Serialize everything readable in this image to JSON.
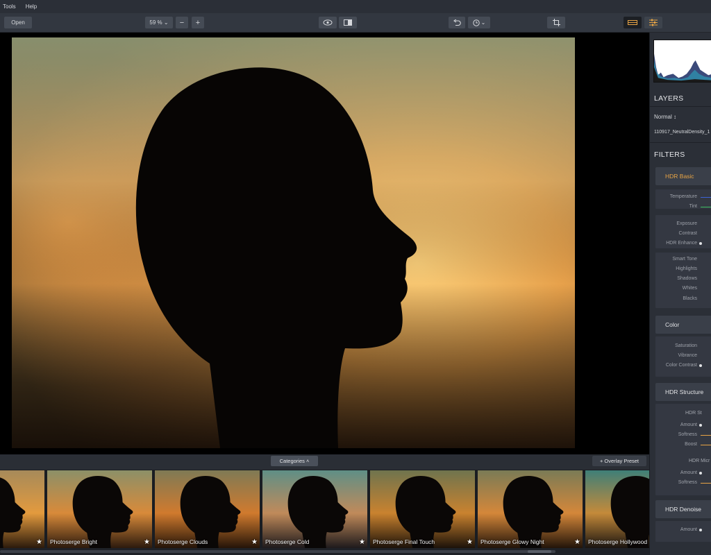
{
  "menu": {
    "items": [
      {
        "label": "Tools"
      },
      {
        "label": "Help"
      }
    ]
  },
  "toolbar": {
    "open_label": "Open",
    "zoom_label": "59 % ⌄",
    "zoom_out_label": "−",
    "zoom_in_label": "+",
    "history_label": "⌄"
  },
  "panel": {
    "layers_title": "LAYERS",
    "blend_mode": "Normal ↕",
    "layer_name": "110917_NeutralDensity_1",
    "filters_title": "FILTERS",
    "hdr_basic": {
      "title": "HDR Basic",
      "g1": [
        "Temperature",
        "Tint"
      ],
      "g2": [
        "Exposure",
        "Contrast",
        "HDR Enhance"
      ],
      "g3": [
        "Smart Tone",
        "Highlights",
        "Shadows",
        "Whites",
        "Blacks"
      ]
    },
    "color": {
      "title": "Color",
      "rows": [
        "Saturation",
        "Vibrance",
        "Color Contrast"
      ]
    },
    "hdr_structure": {
      "title": "HDR Structure",
      "sub1": "HDR St",
      "sub1_rows": [
        "Amount",
        "Softness",
        "Boost"
      ],
      "sub2": "HDR Micr",
      "sub2_rows": [
        "Amount",
        "Softness"
      ]
    },
    "hdr_denoise": {
      "title": "HDR Denoise",
      "rows": [
        "Amount"
      ]
    }
  },
  "strip": {
    "categories_label": "Categories ˄",
    "overlay_label": "+ Overlay Preset",
    "presets": [
      {
        "label": ""
      },
      {
        "label": "Photoserge Bright"
      },
      {
        "label": "Photoserge Clouds"
      },
      {
        "label": "Photoserge Cold"
      },
      {
        "label": "Photoserge Final Touch"
      },
      {
        "label": "Photoserge Glowy Night"
      },
      {
        "label": "Photoserge Hollywood"
      }
    ]
  }
}
